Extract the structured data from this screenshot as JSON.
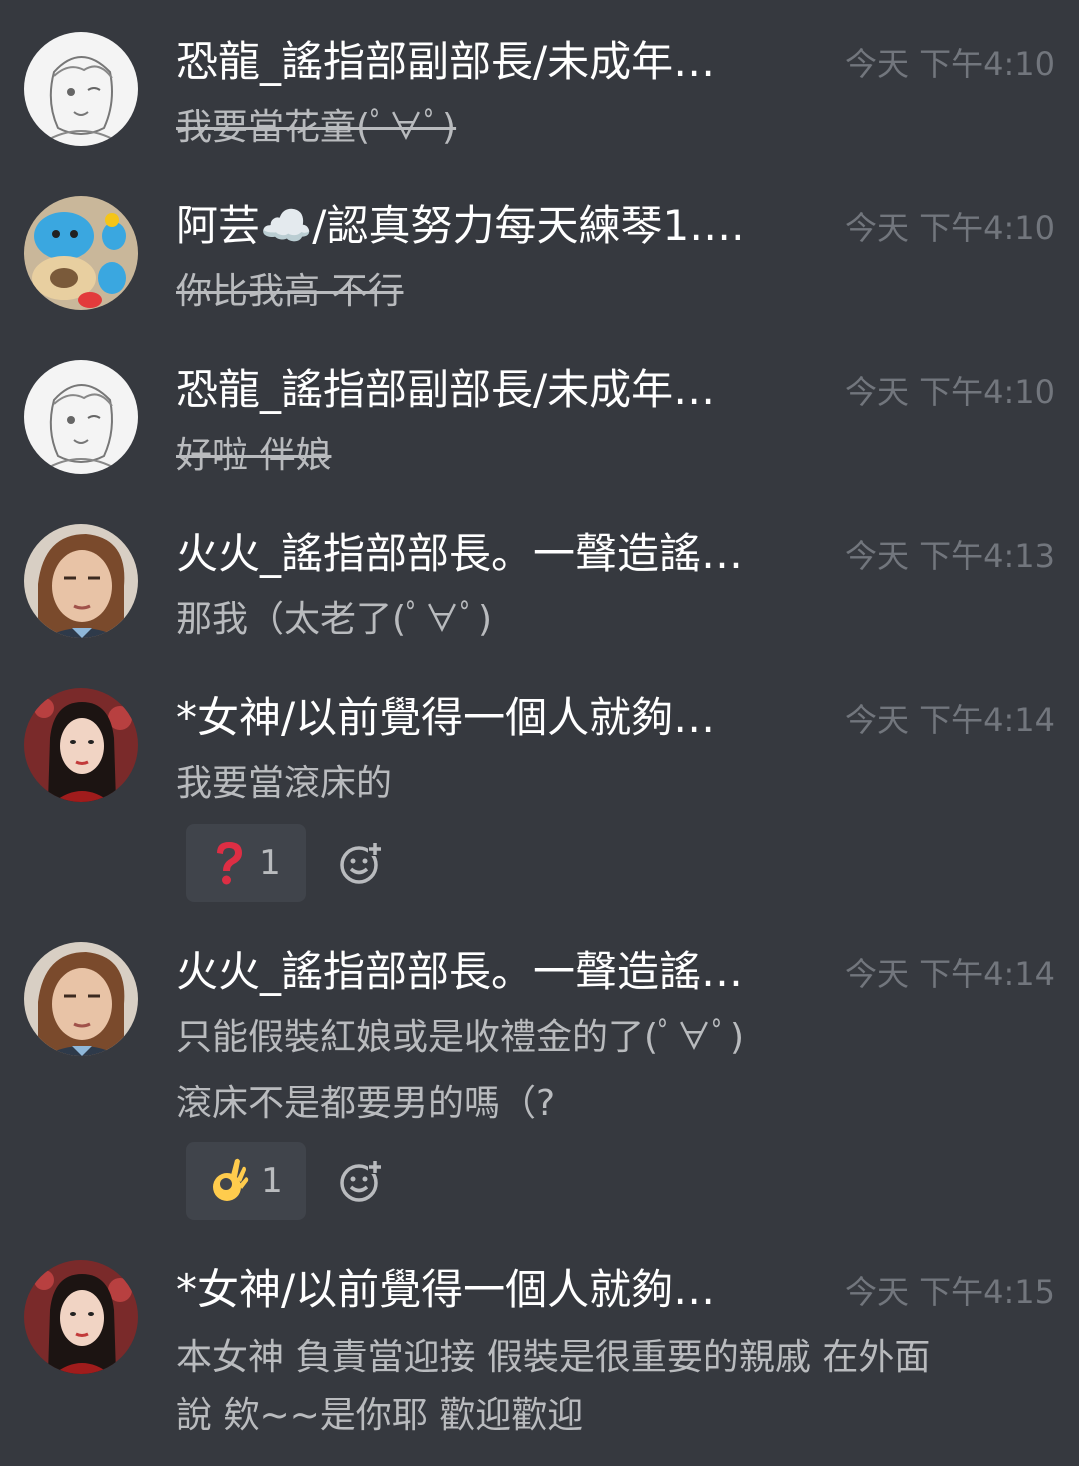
{
  "messages": [
    {
      "username": "恐龍_謠指部副部長/未成年…",
      "timestamp": "今天 下午4:10",
      "lines": [
        "我要當花童(ﾟ∀ﾟ)"
      ],
      "struck": true
    },
    {
      "username": "阿芸☁️/認真努力每天練琴1….",
      "timestamp": "今天 下午4:10",
      "lines": [
        "你比我高 不行"
      ],
      "struck": true
    },
    {
      "username": "恐龍_謠指部副部長/未成年…",
      "timestamp": "今天 下午4:10",
      "lines": [
        "好啦 伴娘"
      ],
      "struck": true
    },
    {
      "username": "火火_謠指部部長。一聲造謠…",
      "timestamp": "今天 下午4:13",
      "lines": [
        "那我（太老了(ﾟ∀ﾟ)"
      ],
      "struck": false
    },
    {
      "username": "*女神/以前覺得一個人就夠…",
      "timestamp": "今天 下午4:14",
      "lines": [
        "我要當滾床的"
      ],
      "struck": false,
      "reaction": {
        "emoji": "❓",
        "count": "1"
      }
    },
    {
      "username": "火火_謠指部部長。一聲造謠…",
      "timestamp": "今天 下午4:14",
      "lines": [
        "只能假裝紅娘或是收禮金的了(ﾟ∀ﾟ)",
        "滾床不是都要男的嗎（?"
      ],
      "struck": false,
      "reaction": {
        "emoji": "👌",
        "count": "1"
      }
    },
    {
      "username": "*女神/以前覺得一個人就夠…",
      "timestamp": "今天 下午4:15",
      "lines": [
        "本女神 負責當迎接 假裝是很重要的親戚 在外面",
        "說 欸~~是你耶 歡迎歡迎"
      ],
      "struck": false
    }
  ],
  "colors": {
    "background": "#36393f",
    "username": "#ffffff",
    "message_text": "#b9bbbe",
    "timestamp": "#72767d",
    "reaction_bg": "#40444b",
    "question_red": "#dd2e44",
    "ok_hand_yellow": "#ffcc4d"
  },
  "icons": {
    "reaction_1": "red-question-mark-icon",
    "reaction_2": "ok-hand-icon",
    "add_reaction": "add-reaction-icon"
  }
}
